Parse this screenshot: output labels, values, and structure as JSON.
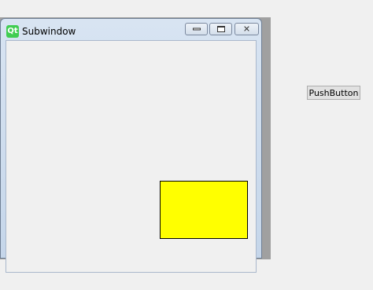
{
  "subwindow": {
    "title": "Subwindow",
    "logo_text": "Qt",
    "icons": {
      "logo": "qt-logo-icon",
      "minimize": "minimize-icon",
      "maximize": "maximize-icon",
      "close": "close-icon"
    },
    "close_glyph": "✕"
  },
  "canvas": {
    "rect_color": "#ffff00"
  },
  "main": {
    "push_button_label": "PushButton"
  }
}
